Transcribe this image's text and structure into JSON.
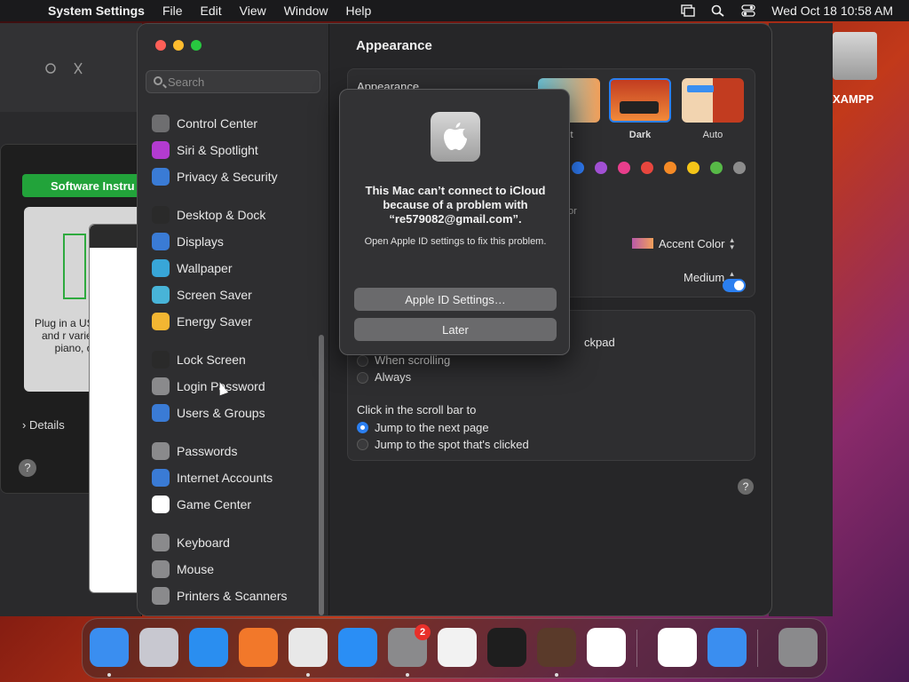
{
  "menubar": {
    "app": "System Settings",
    "items": [
      "File",
      "Edit",
      "View",
      "Window",
      "Help"
    ],
    "clock": "Wed Oct 18  10:58 AM"
  },
  "background": {
    "installer_button": "Software Instru",
    "installer_text": "Plug in a US play and r variety o piano, or",
    "details": "Details",
    "help": "?",
    "desktop_icon_label": "XAMPP"
  },
  "sidebar": {
    "search_placeholder": "Search",
    "items": [
      {
        "label": "Control Center",
        "icon": "control-center-icon",
        "color": "#6e6e70"
      },
      {
        "label": "Siri & Spotlight",
        "icon": "siri-icon",
        "color": "#b33bd0"
      },
      {
        "label": "Privacy & Security",
        "icon": "hand-icon",
        "color": "#3a7bd5"
      },
      {
        "label": "Desktop & Dock",
        "icon": "dock-icon",
        "color": "#2a2a2a"
      },
      {
        "label": "Displays",
        "icon": "sun-icon",
        "color": "#3a7bd5"
      },
      {
        "label": "Wallpaper",
        "icon": "wallpaper-icon",
        "color": "#38a6d8"
      },
      {
        "label": "Screen Saver",
        "icon": "screen-saver-icon",
        "color": "#48b4d8"
      },
      {
        "label": "Energy Saver",
        "icon": "battery-icon",
        "color": "#f2b632"
      },
      {
        "label": "Lock Screen",
        "icon": "lock-screen-icon",
        "color": "#2a2a2a"
      },
      {
        "label": "Login Password",
        "icon": "lock-icon",
        "color": "#8a8a8c"
      },
      {
        "label": "Users & Groups",
        "icon": "users-icon",
        "color": "#3a7bd5"
      },
      {
        "label": "Passwords",
        "icon": "key-icon",
        "color": "#8a8a8c"
      },
      {
        "label": "Internet Accounts",
        "icon": "at-icon",
        "color": "#3a7bd5"
      },
      {
        "label": "Game Center",
        "icon": "game-center-icon",
        "color": "#ffffff"
      },
      {
        "label": "Keyboard",
        "icon": "keyboard-icon",
        "color": "#8a8a8c"
      },
      {
        "label": "Mouse",
        "icon": "mouse-icon",
        "color": "#8a8a8c"
      },
      {
        "label": "Printers & Scanners",
        "icon": "printer-icon",
        "color": "#8a8a8c"
      }
    ]
  },
  "content": {
    "title": "Appearance",
    "appearance_label": "Appearance",
    "modes": [
      "nt",
      "Dark",
      "Auto"
    ],
    "accent_partial": "or",
    "accent_colors": [
      "#2f7cf6",
      "#a250d4",
      "#e83e8c",
      "#e8463e",
      "#f58a26",
      "#f5c518",
      "#57b947",
      "#8c8c8c"
    ],
    "accent_color_popup": "Accent Color",
    "sidebar_size_popup": "Medium",
    "scroll_partial": "ckpad",
    "scroll_options": [
      "When scrolling",
      "Always"
    ],
    "click_label": "Click in the scroll bar to",
    "click_options": [
      "Jump to the next page",
      "Jump to the spot that's clicked"
    ],
    "help": "?"
  },
  "alert": {
    "title": "This Mac can’t connect to iCloud because of a problem with “re579082@gmail.com”.",
    "body": "Open Apple ID settings to fix this problem.",
    "primary_button": "Apple ID Settings…",
    "secondary_button": "Later"
  },
  "dock": {
    "apps": [
      {
        "name": "Finder",
        "icon": "finder-icon",
        "color": "#3a8ef0"
      },
      {
        "name": "Launchpad",
        "icon": "launchpad-icon",
        "color": "#c8c8d0"
      },
      {
        "name": "Safari",
        "icon": "safari-icon",
        "color": "#2a8ef0"
      },
      {
        "name": "Firefox",
        "icon": "firefox-icon",
        "color": "#f2782a"
      },
      {
        "name": "Chrome",
        "icon": "chrome-icon",
        "color": "#e8e8e8"
      },
      {
        "name": "App Store",
        "icon": "app-store-icon",
        "color": "#2a8ef5"
      },
      {
        "name": "System Settings",
        "icon": "gear-icon",
        "color": "#8a8a8c",
        "badge": "2"
      },
      {
        "name": "TextEdit",
        "icon": "textedit-icon",
        "color": "#f2f2f2"
      },
      {
        "name": "Terminal",
        "icon": "terminal-icon",
        "color": "#1e1e1e"
      },
      {
        "name": "GarageBand",
        "icon": "guitar-icon",
        "color": "#5a3a2a"
      },
      {
        "name": "VS Code",
        "icon": "vscode-icon",
        "color": "#ffffff"
      },
      {
        "name": "Visual Studio",
        "icon": "visual-studio-icon",
        "color": "#ffffff"
      },
      {
        "name": "Weather",
        "icon": "weather-icon",
        "color": "#3a8ef0"
      },
      {
        "name": "Trash",
        "icon": "trash-icon",
        "color": "#8a8a8c"
      }
    ]
  }
}
